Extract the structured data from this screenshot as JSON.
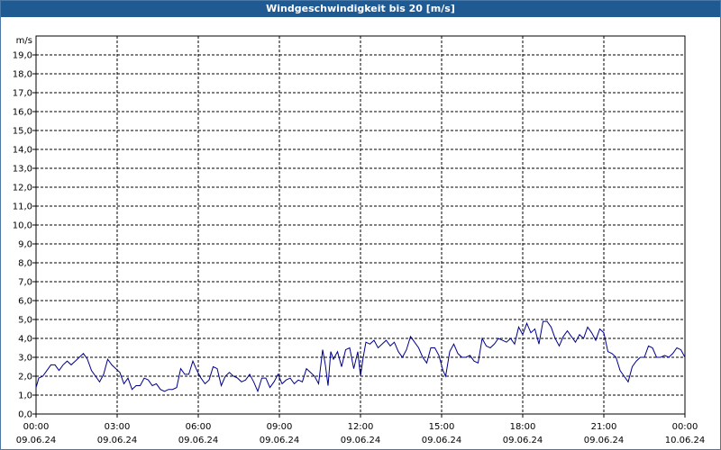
{
  "window": {
    "title": "Windgeschwindigkeit bis 20 [m/s]"
  },
  "colors": {
    "titlebar": "#1f5a93",
    "series": "#00008b",
    "grid": "#000000"
  },
  "chart_data": {
    "type": "line",
    "title": "Windgeschwindigkeit bis 20 [m/s]",
    "ylabel": "m/s",
    "xlabel": "",
    "ylim": [
      0,
      20
    ],
    "xlim_hours": [
      0,
      24
    ],
    "grid": true,
    "y_ticks": [
      "0,0",
      "1,0",
      "2,0",
      "3,0",
      "4,0",
      "5,0",
      "6,0",
      "7,0",
      "8,0",
      "9,0",
      "10,0",
      "11,0",
      "12,0",
      "13,0",
      "14,0",
      "15,0",
      "16,0",
      "17,0",
      "18,0",
      "19,0"
    ],
    "x_ticks": [
      {
        "hour": 0,
        "time": "00:00",
        "date": "09.06.24"
      },
      {
        "hour": 3,
        "time": "03:00",
        "date": "09.06.24"
      },
      {
        "hour": 6,
        "time": "06:00",
        "date": "09.06.24"
      },
      {
        "hour": 9,
        "time": "09:00",
        "date": "09.06.24"
      },
      {
        "hour": 12,
        "time": "12:00",
        "date": "09.06.24"
      },
      {
        "hour": 15,
        "time": "15:00",
        "date": "09.06.24"
      },
      {
        "hour": 18,
        "time": "18:00",
        "date": "09.06.24"
      },
      {
        "hour": 21,
        "time": "21:00",
        "date": "09.06.24"
      },
      {
        "hour": 24,
        "time": "00:00",
        "date": "10.06.24"
      }
    ],
    "series": [
      {
        "values": [
          [
            0.0,
            1.4
          ],
          [
            0.1,
            1.9
          ],
          [
            0.25,
            2.0
          ],
          [
            0.4,
            2.3
          ],
          [
            0.55,
            2.6
          ],
          [
            0.7,
            2.6
          ],
          [
            0.85,
            2.3
          ],
          [
            1.0,
            2.6
          ],
          [
            1.15,
            2.8
          ],
          [
            1.3,
            2.6
          ],
          [
            1.45,
            2.8
          ],
          [
            1.6,
            3.0
          ],
          [
            1.75,
            3.2
          ],
          [
            1.9,
            2.9
          ],
          [
            2.05,
            2.3
          ],
          [
            2.2,
            2.0
          ],
          [
            2.35,
            1.7
          ],
          [
            2.5,
            2.1
          ],
          [
            2.65,
            2.9
          ],
          [
            2.8,
            2.6
          ],
          [
            2.95,
            2.4
          ],
          [
            3.1,
            2.2
          ],
          [
            3.25,
            1.6
          ],
          [
            3.4,
            1.9
          ],
          [
            3.55,
            1.3
          ],
          [
            3.7,
            1.5
          ],
          [
            3.85,
            1.5
          ],
          [
            4.0,
            1.9
          ],
          [
            4.15,
            1.8
          ],
          [
            4.3,
            1.5
          ],
          [
            4.45,
            1.6
          ],
          [
            4.6,
            1.3
          ],
          [
            4.75,
            1.2
          ],
          [
            4.9,
            1.3
          ],
          [
            5.05,
            1.3
          ],
          [
            5.2,
            1.4
          ],
          [
            5.35,
            2.4
          ],
          [
            5.5,
            2.1
          ],
          [
            5.65,
            2.1
          ],
          [
            5.8,
            2.8
          ],
          [
            5.95,
            2.3
          ],
          [
            6.1,
            1.9
          ],
          [
            6.25,
            1.6
          ],
          [
            6.4,
            1.8
          ],
          [
            6.55,
            2.5
          ],
          [
            6.7,
            2.4
          ],
          [
            6.85,
            1.5
          ],
          [
            7.0,
            2.0
          ],
          [
            7.15,
            2.2
          ],
          [
            7.3,
            2.0
          ],
          [
            7.45,
            1.9
          ],
          [
            7.6,
            1.7
          ],
          [
            7.75,
            1.8
          ],
          [
            7.9,
            2.1
          ],
          [
            8.05,
            1.7
          ],
          [
            8.2,
            1.2
          ],
          [
            8.35,
            1.9
          ],
          [
            8.5,
            1.9
          ],
          [
            8.65,
            1.4
          ],
          [
            8.8,
            1.7
          ],
          [
            8.95,
            2.1
          ],
          [
            9.1,
            1.6
          ],
          [
            9.25,
            1.8
          ],
          [
            9.4,
            1.9
          ],
          [
            9.55,
            1.6
          ],
          [
            9.7,
            1.8
          ],
          [
            9.85,
            1.7
          ],
          [
            10.0,
            2.4
          ],
          [
            10.15,
            2.2
          ],
          [
            10.3,
            2.0
          ],
          [
            10.45,
            1.6
          ],
          [
            10.6,
            3.4
          ],
          [
            10.7,
            2.6
          ],
          [
            10.8,
            1.5
          ],
          [
            10.9,
            3.3
          ],
          [
            11.0,
            2.9
          ],
          [
            11.15,
            3.3
          ],
          [
            11.3,
            2.5
          ],
          [
            11.45,
            3.4
          ],
          [
            11.6,
            3.5
          ],
          [
            11.75,
            2.4
          ],
          [
            11.9,
            3.3
          ],
          [
            12.0,
            2.0
          ],
          [
            12.1,
            3.0
          ],
          [
            12.2,
            3.8
          ],
          [
            12.35,
            3.7
          ],
          [
            12.5,
            3.9
          ],
          [
            12.65,
            3.5
          ],
          [
            12.8,
            3.7
          ],
          [
            12.95,
            3.9
          ],
          [
            13.1,
            3.6
          ],
          [
            13.25,
            3.8
          ],
          [
            13.4,
            3.3
          ],
          [
            13.55,
            3.0
          ],
          [
            13.7,
            3.4
          ],
          [
            13.85,
            4.1
          ],
          [
            14.0,
            3.8
          ],
          [
            14.15,
            3.5
          ],
          [
            14.3,
            3.0
          ],
          [
            14.45,
            2.7
          ],
          [
            14.6,
            3.5
          ],
          [
            14.75,
            3.5
          ],
          [
            14.9,
            3.1
          ],
          [
            15.05,
            2.3
          ],
          [
            15.15,
            2.0
          ],
          [
            15.3,
            3.3
          ],
          [
            15.45,
            3.7
          ],
          [
            15.6,
            3.2
          ],
          [
            15.75,
            3.0
          ],
          [
            15.9,
            3.0
          ],
          [
            16.05,
            3.1
          ],
          [
            16.2,
            2.8
          ],
          [
            16.35,
            2.7
          ],
          [
            16.5,
            4.0
          ],
          [
            16.65,
            3.6
          ],
          [
            16.8,
            3.5
          ],
          [
            16.95,
            3.7
          ],
          [
            17.1,
            4.0
          ],
          [
            17.25,
            3.9
          ],
          [
            17.4,
            3.8
          ],
          [
            17.55,
            4.0
          ],
          [
            17.7,
            3.7
          ],
          [
            17.85,
            4.6
          ],
          [
            18.0,
            4.2
          ],
          [
            18.15,
            4.8
          ],
          [
            18.3,
            4.3
          ],
          [
            18.45,
            4.5
          ],
          [
            18.6,
            3.7
          ],
          [
            18.75,
            4.9
          ],
          [
            18.9,
            4.9
          ],
          [
            19.05,
            4.6
          ],
          [
            19.2,
            4.0
          ],
          [
            19.35,
            3.6
          ],
          [
            19.5,
            4.1
          ],
          [
            19.65,
            4.4
          ],
          [
            19.8,
            4.1
          ],
          [
            19.95,
            3.8
          ],
          [
            20.1,
            4.2
          ],
          [
            20.25,
            4.0
          ],
          [
            20.4,
            4.6
          ],
          [
            20.55,
            4.3
          ],
          [
            20.7,
            3.9
          ],
          [
            20.85,
            4.5
          ],
          [
            21.0,
            4.3
          ],
          [
            21.15,
            3.3
          ],
          [
            21.3,
            3.2
          ],
          [
            21.45,
            3.0
          ],
          [
            21.6,
            2.3
          ],
          [
            21.75,
            2.0
          ],
          [
            21.9,
            1.7
          ],
          [
            22.05,
            2.5
          ],
          [
            22.2,
            2.8
          ],
          [
            22.35,
            3.0
          ],
          [
            22.5,
            3.0
          ],
          [
            22.65,
            3.6
          ],
          [
            22.8,
            3.5
          ],
          [
            22.95,
            3.0
          ],
          [
            23.1,
            3.0
          ],
          [
            23.25,
            3.1
          ],
          [
            23.4,
            3.0
          ],
          [
            23.55,
            3.2
          ],
          [
            23.7,
            3.5
          ],
          [
            23.85,
            3.4
          ],
          [
            24.0,
            3.0
          ]
        ]
      }
    ]
  }
}
